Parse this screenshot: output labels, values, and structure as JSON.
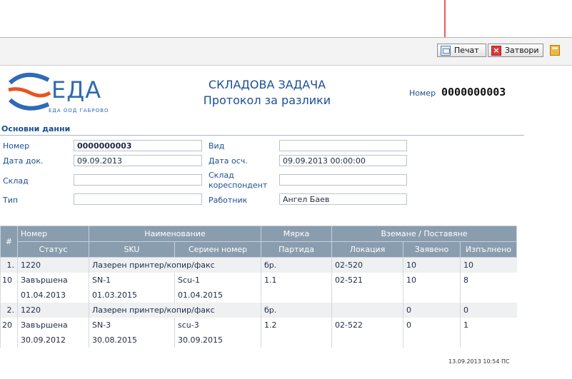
{
  "toolbar": {
    "print_label": "Печат",
    "close_label": "Затвори"
  },
  "logo": {
    "name": "ЕДА",
    "sub": "ЕДА ООД ГАБРОВО"
  },
  "doc": {
    "title_1": "СКЛАДОВА ЗАДАЧА",
    "title_2": "Протокол за разлики",
    "number_label": "Номер",
    "number_value": "0000000003"
  },
  "section_title": "Основни данни",
  "fields": {
    "number_label": "Номер",
    "number_value": "0000000003",
    "type_label": "Вид",
    "type_value": "",
    "doc_date_label": "Дата док.",
    "doc_date_value": "09.09.2013",
    "post_date_label": "Дата осч.",
    "post_date_value": "09.09.2013 00:00:00",
    "warehouse_label": "Склад",
    "warehouse_value": "",
    "corr_label_1": "Склад",
    "corr_label_2": "кореспондент",
    "corr_value": "",
    "tip_label": "Тип",
    "tip_value": "",
    "worker_label": "Работник",
    "worker_value": "Ангел Баев"
  },
  "table": {
    "header_row1": {
      "hash": "#",
      "number": "Номер",
      "name": "Наименование",
      "unit": "Мярка",
      "take_put": "Вземане / Поставяне"
    },
    "header_row2": {
      "status": "Статус",
      "sku": "SKU",
      "serial": "Сериен номер",
      "batch": "Партида",
      "location": "Локация",
      "requested": "Заявено",
      "done": "Изпълнено"
    },
    "rows": [
      [
        "1.",
        "1220",
        "Лазерен принтер/копир/факс",
        "",
        "бр.",
        "02-520",
        "10",
        "10"
      ],
      [
        "10",
        "Завършена",
        "SN-1",
        "Scu-1",
        "1.1",
        "02-521",
        "10",
        "8"
      ],
      [
        "",
        "01.04.2013",
        "01.03.2015",
        "01.04.2015",
        "",
        "",
        "",
        ""
      ],
      [
        "2.",
        "1220",
        "Лазерен принтер/копир/факс",
        "",
        "бр.",
        "",
        "0",
        "0"
      ],
      [
        "20",
        "Завършена",
        "SN-3",
        "scu-3",
        "1.2",
        "02-522",
        "0",
        "1"
      ],
      [
        "",
        "30.09.2012",
        "30.08.2015",
        "30.09.2015",
        "",
        "",
        "",
        ""
      ]
    ]
  },
  "footer": "13.09.2013 10:54  ПС",
  "colors": {
    "header_bg": "#8a9daf",
    "title_blue": "#1b4f92",
    "annotation_red": "#e8232a"
  },
  "icons": [
    "print-icon",
    "close-icon",
    "calculator-icon"
  ]
}
